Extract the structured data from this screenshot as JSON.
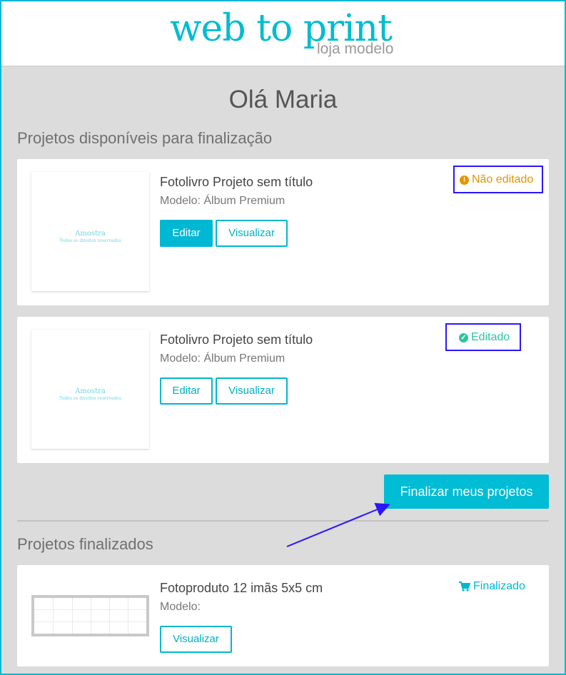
{
  "header": {
    "logo_main": "web to print",
    "logo_sub": "loja modelo"
  },
  "greeting": "Olá Maria",
  "available_section": {
    "title": "Projetos disponíveis para finalização",
    "projects": [
      {
        "title": "Fotolivro Projeto sem título",
        "model": "Modelo: Álbum Premium",
        "edit_label": "Editar",
        "view_label": "Visualizar",
        "status": "Não editado",
        "status_color": "#e59400",
        "status_icon": "exclamation-icon",
        "watermark_title": "Amostra",
        "watermark_sub": "Todos os direitos reservados"
      },
      {
        "title": "Fotolivro Projeto sem título",
        "model": "Modelo: Álbum Premium",
        "edit_label": "Editar",
        "view_label": "Visualizar",
        "status": "Editado",
        "status_color": "#2ec4a0",
        "status_icon": "check-icon",
        "watermark_title": "Amostra",
        "watermark_sub": "Todos os direitos reservados"
      }
    ],
    "finalize_label": "Finalizar meus projetos"
  },
  "finished_section": {
    "title": "Projetos finalizados",
    "projects": [
      {
        "title": "Fotoproduto 12 imãs 5x5 cm",
        "model": "Modelo:",
        "view_label": "Visualizar",
        "status": "Finalizado",
        "status_color": "#00b8d4",
        "status_icon": "cart-icon"
      }
    ]
  },
  "colors": {
    "accent": "#00b8d4",
    "highlight": "#2a16ff",
    "background": "#dcdcdc"
  }
}
